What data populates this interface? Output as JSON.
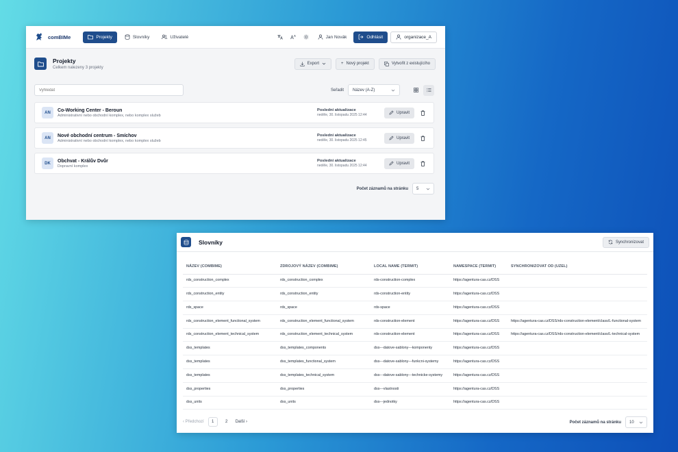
{
  "projects_window": {
    "brand": "comBIMe",
    "nav": [
      {
        "label": "Projekty",
        "active": true
      },
      {
        "label": "Slovníky",
        "active": false
      },
      {
        "label": "Uživatelé",
        "active": false
      }
    ],
    "user_name": "Jan Novák",
    "logout_label": "Odhlásit",
    "organization": "organizace_A",
    "page_title": "Projekty",
    "page_subtitle": "Celkem nalezeny 3 projekty",
    "export_label": "Export",
    "new_project_label": "Nový projekt",
    "create_from_existing_label": "Vytvořit z existujícího",
    "search_placeholder": "Vyhledat",
    "sort_label": "Seřadit",
    "sort_value": "Název (A-Z)",
    "projects": [
      {
        "initials": "AN",
        "name": "Co-Working Center - Beroun",
        "description": "Administrativní nebo obchodní komplex, nebo komplex služeb",
        "updated_label": "Poslední aktualizace",
        "updated": "neděle, 30. listopadu 2025 12:44",
        "edit_label": "Upravit"
      },
      {
        "initials": "AN",
        "name": "Nové obchodní centrum - Smíchov",
        "description": "Administrativní nebo obchodní komplex, nebo komplex služeb",
        "updated_label": "Poslední aktualizace",
        "updated": "neděle, 30. listopadu 2025 12:45",
        "edit_label": "Upravit"
      },
      {
        "initials": "DK",
        "name": "Obchvat - Králův Dvůr",
        "description": "Dopravní komplex",
        "updated_label": "Poslední aktualizace",
        "updated": "neděle, 30. listopadu 2025 12:44",
        "edit_label": "Upravit"
      }
    ],
    "per_page_label": "Počet záznamů na stránku",
    "per_page_value": "5"
  },
  "dict_window": {
    "title": "Slovníky",
    "sync_label": "Synchronizovat",
    "columns": [
      "NÁZEV (COMBIME)",
      "ZDROJOVÝ NÁZEV (COMBIME)",
      "LOCAL NAME (TERMIT)",
      "NAMESPACE (TERMIT)",
      "SYNCHRONIZOVAT OD (UZEL)"
    ],
    "rows": [
      [
        "rds_construction_complex",
        "rds_construction_complex",
        "rds-construction-complex",
        "https://agentura-cas.cz/DSS",
        ""
      ],
      [
        "rds_construction_entity",
        "rds_construction_entity",
        "rds-construction-entity",
        "https://agentura-cas.cz/DSS",
        ""
      ],
      [
        "rds_space",
        "rds_space",
        "rds-space",
        "https://agentura-cas.cz/DSS",
        ""
      ],
      [
        "rds_construction_element_functional_system",
        "rds_construction_element_functional_system",
        "rds-construction-element",
        "https://agentura-cas.cz/DSS",
        "https://agentura-cas.cz/DSS/rds-construction-element/class/L-functional-system"
      ],
      [
        "rds_construction_element_technical_system",
        "rds_construction_element_technical_system",
        "rds-construction-element",
        "https://agentura-cas.cz/DSS",
        "https://agentura-cas.cz/DSS/rds-construction-element/class/L-technical-system"
      ],
      [
        "dss_templates",
        "dss_templates_components",
        "dss---datove-sablony---komponenty",
        "https://agentura-cas.cz/DSS",
        ""
      ],
      [
        "dss_templates",
        "dss_templates_functional_system",
        "dss---datove-sablony---funkcni-systemy",
        "https://agentura-cas.cz/DSS",
        ""
      ],
      [
        "dss_templates",
        "dss_templates_technical_system",
        "dss---datove-sablony---technicke-systemy",
        "https://agentura-cas.cz/DSS",
        ""
      ],
      [
        "dss_properties",
        "dss_properties",
        "dss---vlastnosti",
        "https://agentura-cas.cz/DSS",
        ""
      ],
      [
        "dss_units",
        "dss_units",
        "dss---jednotky",
        "https://agentura-cas.cz/DSS",
        ""
      ]
    ],
    "prev_label": "Předchozí",
    "pages": [
      "1",
      "2"
    ],
    "current_page": "1",
    "next_label": "Další",
    "per_page_label": "Počet záznamů na stránku",
    "per_page_value": "10"
  },
  "colors": {
    "primary": "#1f4d8c",
    "avatar_bg": "#dbe5f5"
  }
}
